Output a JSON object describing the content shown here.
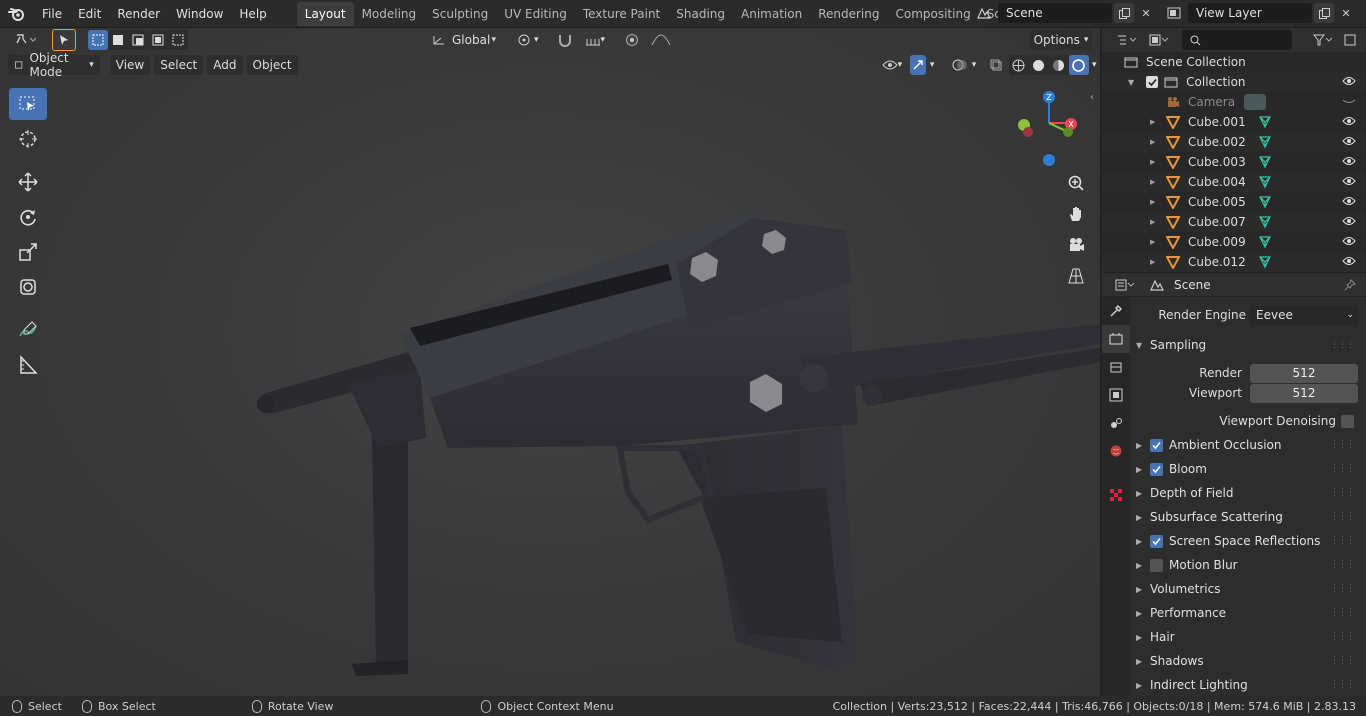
{
  "topbar": {
    "menus": [
      "File",
      "Edit",
      "Render",
      "Window",
      "Help"
    ],
    "tabs": [
      "Layout",
      "Modeling",
      "Sculpting",
      "UV Editing",
      "Texture Paint",
      "Shading",
      "Animation",
      "Rendering",
      "Compositing",
      "Scripting"
    ],
    "active_tab": "Layout",
    "scene": "Scene",
    "view_layer": "View Layer"
  },
  "viewport": {
    "transform_orientation": "Global",
    "options_label": "Options",
    "mode": "Object Mode",
    "menus": [
      "View",
      "Select",
      "Add",
      "Object"
    ]
  },
  "outliner": {
    "root": "Scene Collection",
    "collection": "Collection",
    "items": [
      "Camera",
      "Cube.001",
      "Cube.002",
      "Cube.003",
      "Cube.004",
      "Cube.005",
      "Cube.007",
      "Cube.009",
      "Cube.012"
    ]
  },
  "properties": {
    "context": "Scene",
    "render_engine_label": "Render Engine",
    "render_engine": "Eevee",
    "sampling_label": "Sampling",
    "render_label": "Render",
    "render_samples": "512",
    "viewport_label": "Viewport",
    "viewport_samples": "512",
    "denoising_label": "Viewport Denoising",
    "panels": [
      {
        "label": "Ambient Occlusion",
        "checkbox": true,
        "checked": true
      },
      {
        "label": "Bloom",
        "checkbox": true,
        "checked": true
      },
      {
        "label": "Depth of Field",
        "checkbox": false
      },
      {
        "label": "Subsurface Scattering",
        "checkbox": false
      },
      {
        "label": "Screen Space Reflections",
        "checkbox": true,
        "checked": true
      },
      {
        "label": "Motion Blur",
        "checkbox": true,
        "checked": false
      },
      {
        "label": "Volumetrics",
        "checkbox": false
      },
      {
        "label": "Performance",
        "checkbox": false
      },
      {
        "label": "Hair",
        "checkbox": false
      },
      {
        "label": "Shadows",
        "checkbox": false
      },
      {
        "label": "Indirect Lighting",
        "checkbox": false
      }
    ]
  },
  "statusbar": {
    "select": "Select",
    "box_select": "Box Select",
    "rotate_view": "Rotate View",
    "context_menu": "Object Context Menu",
    "stats": "Collection | Verts:23,512 | Faces:22,444 | Tris:46,766 | Objects:0/18 | Mem: 574.6 MiB | 2.83.13"
  },
  "colors": {
    "accent": "#4772b3",
    "axis_x": "#e8474f",
    "axis_y": "#8ac33b",
    "axis_z": "#2d7fd4",
    "mesh_icon": "#38c4a6",
    "object_icon": "#e8953b"
  }
}
